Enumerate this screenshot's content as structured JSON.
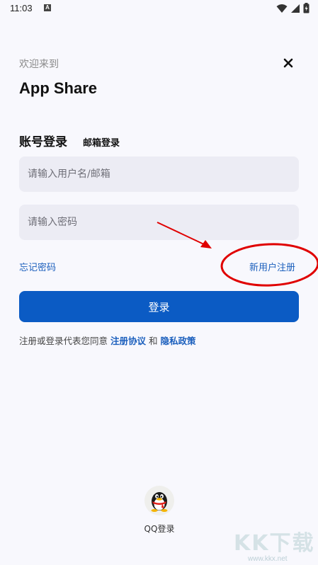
{
  "status_bar": {
    "time": "11:03",
    "notification_letter": "A"
  },
  "header": {
    "greeting": "欢迎来到",
    "app_name": "App Share"
  },
  "tabs": {
    "account_login": "账号登录",
    "email_login": "邮箱登录"
  },
  "form": {
    "username_placeholder": "请输入用户名/邮箱",
    "password_placeholder": "请输入密码",
    "forgot_password": "忘记密码",
    "register": "新用户注册",
    "login_button": "登录"
  },
  "agreement": {
    "prefix": "注册或登录代表您同意 ",
    "terms": "注册协议",
    "and": " 和 ",
    "privacy": "隐私政策"
  },
  "social": {
    "qq_label": "QQ登录"
  },
  "watermark": {
    "brand": "KK下载",
    "url": "www.kkx.net"
  },
  "colors": {
    "primary": "#0b5bc4",
    "link": "#1b5fbd",
    "annotation": "#e00000",
    "background": "#f8f8fd"
  }
}
